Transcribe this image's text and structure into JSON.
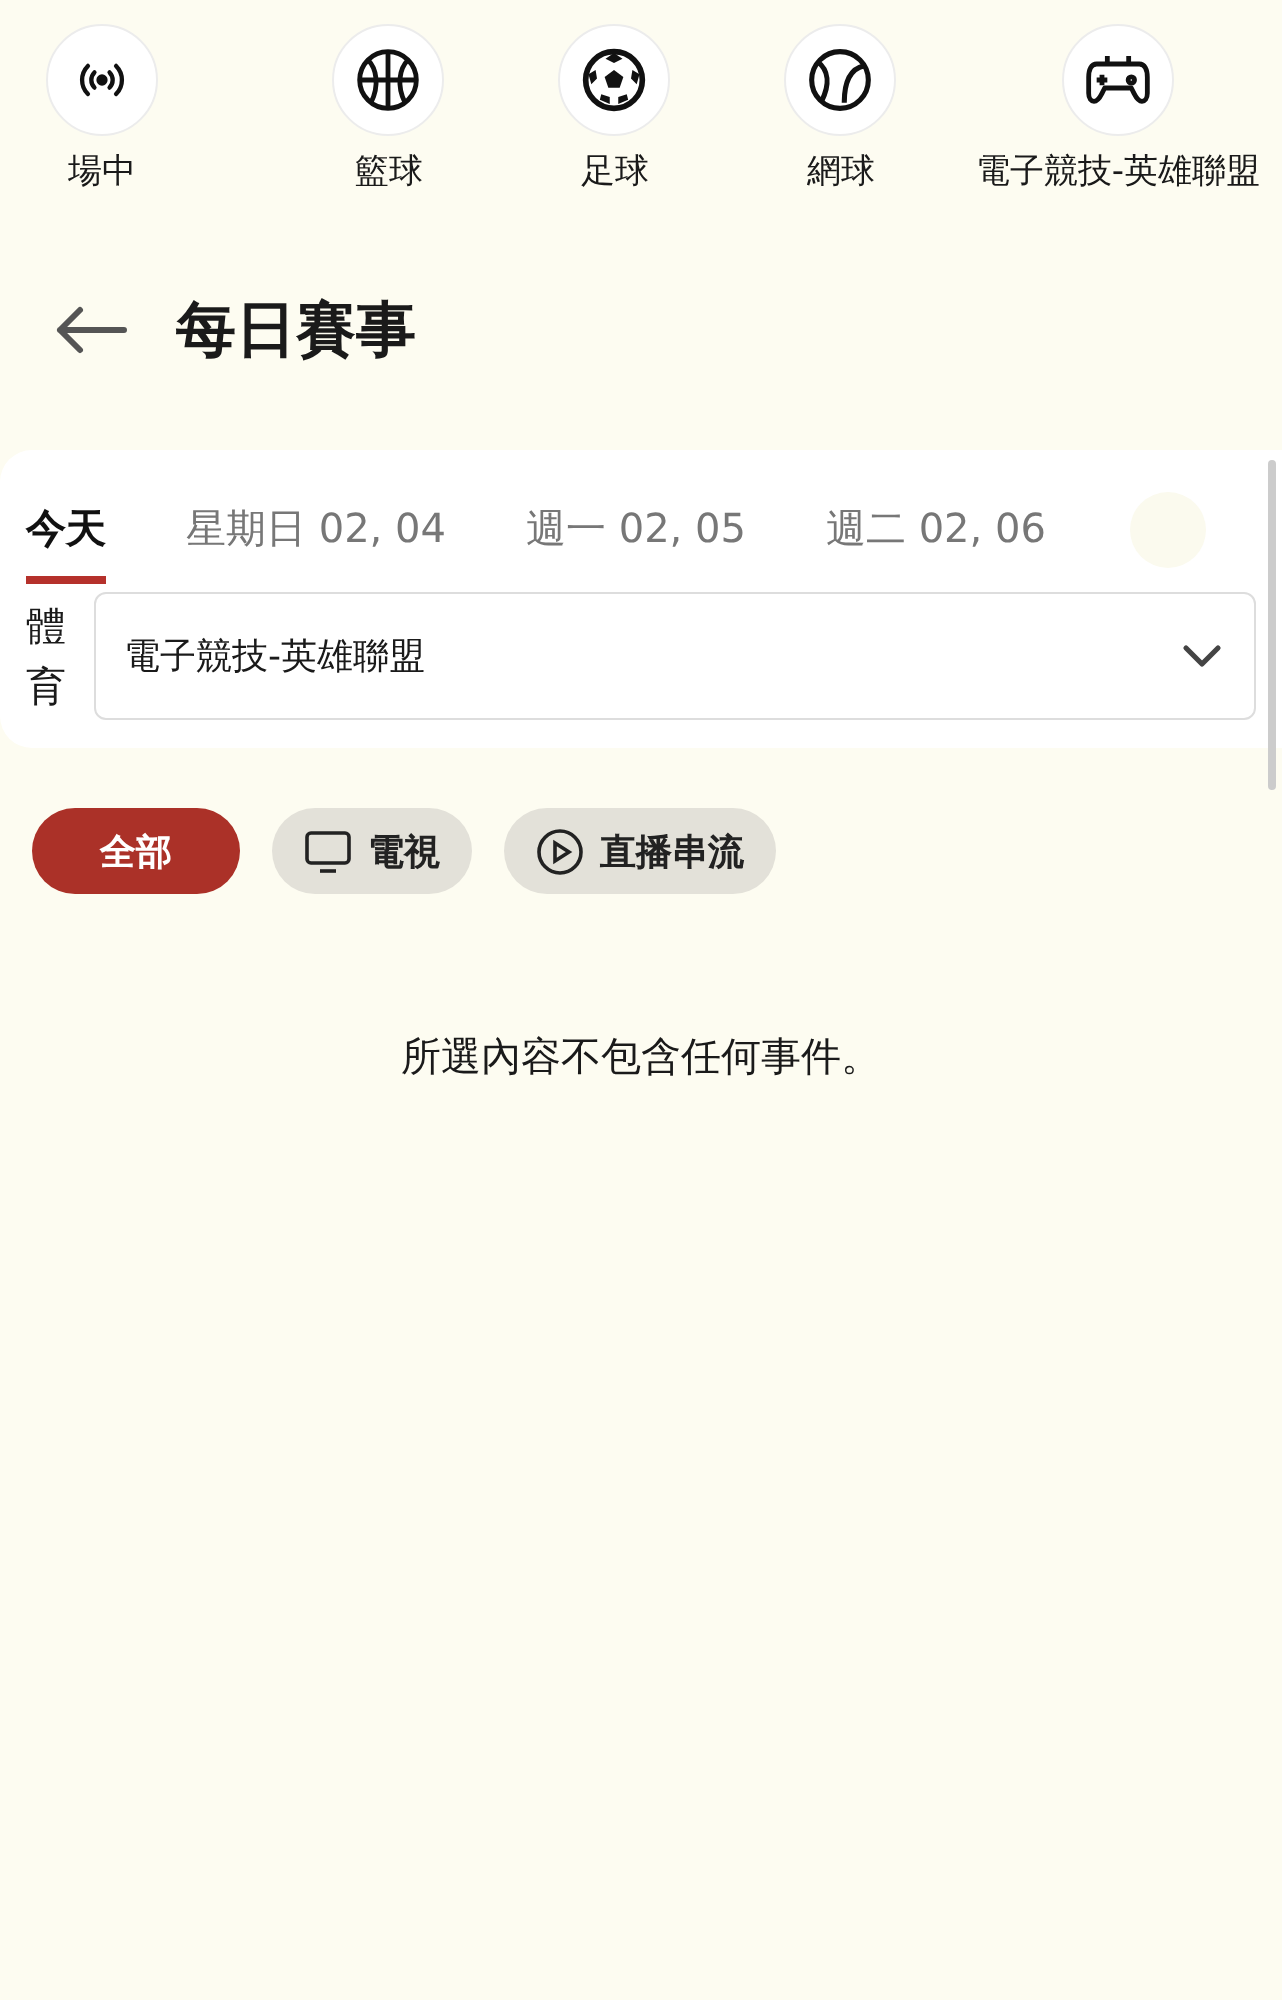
{
  "sports": [
    {
      "kind": "live",
      "label": "場中"
    },
    {
      "kind": "basketball",
      "label": "籃球"
    },
    {
      "kind": "soccer",
      "label": "足球"
    },
    {
      "kind": "tennis",
      "label": "網球"
    },
    {
      "kind": "esports",
      "label": "電子競技-英雄聯盟"
    }
  ],
  "title": "每日賽事",
  "date_tabs": [
    {
      "label": "今天",
      "selected": true
    },
    {
      "label": "星期日 02, 04",
      "selected": false
    },
    {
      "label": "週一 02, 05",
      "selected": false
    },
    {
      "label": "週二 02, 06",
      "selected": false
    }
  ],
  "sport_filter": {
    "label": "體育",
    "value": "電子競技-英雄聯盟"
  },
  "filters": [
    {
      "kind": "all",
      "label": "全部",
      "selected": true
    },
    {
      "kind": "tv",
      "label": "電視",
      "selected": false
    },
    {
      "kind": "stream",
      "label": "直播串流",
      "selected": false
    }
  ],
  "empty_message": "所選內容不包含任何事件。"
}
